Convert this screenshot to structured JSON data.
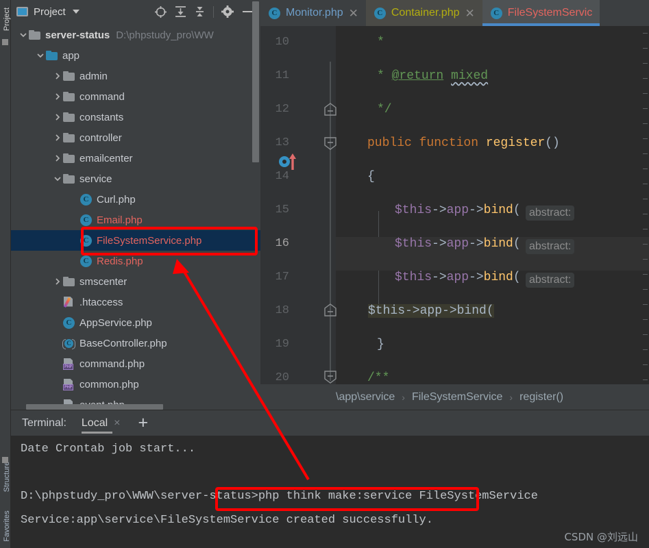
{
  "tool_strip": {
    "project_label": "Project",
    "structure_label": "Structure",
    "favorites_label": "Favorites"
  },
  "project_panel": {
    "title": "Project",
    "icons": [
      "project-icon",
      "chevron-down-icon",
      "locate-file-icon",
      "expand-all-icon",
      "collapse-all-icon",
      "gear-icon",
      "hide-icon"
    ],
    "tree": [
      {
        "label": "server-status",
        "path": "D:\\phpstudy_pro\\WW",
        "kind": "folder",
        "depth": 0,
        "arrow": "down",
        "bold": true
      },
      {
        "label": "app",
        "kind": "folder-blue",
        "depth": 1,
        "arrow": "down"
      },
      {
        "label": "admin",
        "kind": "folder",
        "depth": 2,
        "arrow": "right"
      },
      {
        "label": "command",
        "kind": "folder",
        "depth": 2,
        "arrow": "right"
      },
      {
        "label": "constants",
        "kind": "folder",
        "depth": 2,
        "arrow": "right"
      },
      {
        "label": "controller",
        "kind": "folder",
        "depth": 2,
        "arrow": "right"
      },
      {
        "label": "emailcenter",
        "kind": "folder",
        "depth": 2,
        "arrow": "right"
      },
      {
        "label": "service",
        "kind": "folder",
        "depth": 2,
        "arrow": "down"
      },
      {
        "label": "Curl.php",
        "kind": "class",
        "depth": 3,
        "arrow": "none"
      },
      {
        "label": "Email.php",
        "kind": "class",
        "depth": 3,
        "arrow": "none",
        "red": true
      },
      {
        "label": "FileSystemService.php",
        "kind": "class",
        "depth": 3,
        "arrow": "none",
        "red": true,
        "selected": true
      },
      {
        "label": "Redis.php",
        "kind": "class",
        "depth": 3,
        "arrow": "none",
        "red": true
      },
      {
        "label": "smscenter",
        "kind": "folder",
        "depth": 2,
        "arrow": "right"
      },
      {
        "label": ".htaccess",
        "kind": "htaccess",
        "depth": 2,
        "arrow": "none"
      },
      {
        "label": "AppService.php",
        "kind": "class",
        "depth": 2,
        "arrow": "none"
      },
      {
        "label": "BaseController.php",
        "kind": "abstract-class",
        "depth": 2,
        "arrow": "none"
      },
      {
        "label": "command.php",
        "kind": "php",
        "depth": 2,
        "arrow": "none"
      },
      {
        "label": "common.php",
        "kind": "php",
        "depth": 2,
        "arrow": "none"
      },
      {
        "label": "event.php",
        "kind": "php",
        "depth": 2,
        "arrow": "none"
      }
    ]
  },
  "editor": {
    "tabs": [
      {
        "label": "Monitor.php",
        "color": "#6e9ec9",
        "active": false,
        "closable": true
      },
      {
        "label": "Container.php",
        "color": "#b3ae10",
        "active": false,
        "closable": true
      },
      {
        "label": "FileSystemServic",
        "color": "#e4655f",
        "active": true,
        "closable": false
      }
    ],
    "line_numbers": [
      "10",
      "11",
      "12",
      "13",
      "14",
      "15",
      "16",
      "17",
      "18",
      "19",
      "20"
    ],
    "current_line": "16",
    "code_lines": [
      {
        "n": "10",
        "text": "*"
      },
      {
        "n": "11",
        "text": "* @return mixed"
      },
      {
        "n": "12",
        "text": "*/"
      },
      {
        "n": "13",
        "text": "public function register()"
      },
      {
        "n": "14",
        "text": "{"
      },
      {
        "n": "15",
        "text": "$this->app->bind("
      },
      {
        "n": "16",
        "text": "$this->app->bind("
      },
      {
        "n": "17",
        "text": "$this->app->bind("
      },
      {
        "n": "18",
        "text": "}"
      },
      {
        "n": "19",
        "text": ""
      },
      {
        "n": "20",
        "text": "/**"
      }
    ],
    "inlay_hint": "abstract:",
    "breadcrumb": [
      "\\app\\service",
      "FileSystemService",
      "register()"
    ],
    "breadcrumb_separator": "›"
  },
  "terminal": {
    "title": "Terminal:",
    "tab_label": "Local",
    "close_label": "×",
    "add_label": "+",
    "lines": [
      "Date Crontab job start...",
      "D:\\phpstudy_pro\\WWW\\server-status>php think make:service FileSystemService",
      "Service:app\\service\\FileSystemService created successfully."
    ]
  },
  "watermark": "CSDN @刘远山",
  "annotations": {
    "color": "#fe0000",
    "highlight_tree_item": "FileSystemService.php",
    "highlight_command": "php think make:service FileSystemService"
  }
}
